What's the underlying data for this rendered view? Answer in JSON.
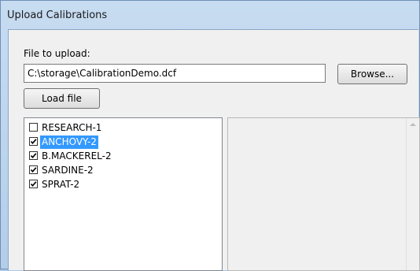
{
  "window": {
    "title": "Upload Calibrations"
  },
  "file": {
    "label": "File to upload:",
    "value": "C:\\storage\\CalibrationDemo.dcf",
    "browse_label": "Browse...",
    "load_label": "Load file"
  },
  "calibrations": [
    {
      "label": "RESEARCH-1",
      "checked": false,
      "selected": false
    },
    {
      "label": "ANCHOVY-2",
      "checked": true,
      "selected": true
    },
    {
      "label": "B.MACKEREL-2",
      "checked": true,
      "selected": false
    },
    {
      "label": "SARDINE-2",
      "checked": true,
      "selected": false
    },
    {
      "label": "SPRAT-2",
      "checked": true,
      "selected": false
    }
  ],
  "colors": {
    "selection": "#3399ff",
    "frame": "#b4cde8"
  }
}
